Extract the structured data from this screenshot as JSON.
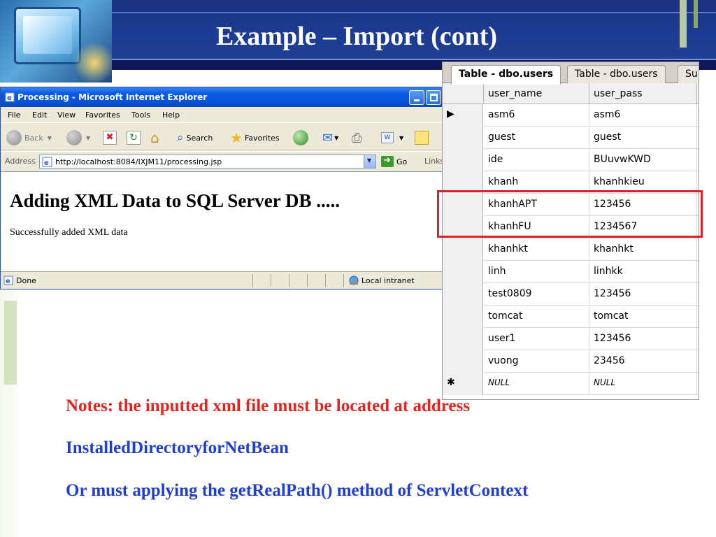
{
  "slide": {
    "title": "Example – Import (cont)",
    "colors": {
      "title_band": "#1c3c94",
      "accent_green": "#b7cf8e",
      "note_red": "#e8221c",
      "note_blue": "#1f3fd0",
      "highlight_red": "#e0202a"
    }
  },
  "browser": {
    "window_title": "Processing - Microsoft Internet Explorer",
    "menu": [
      "File",
      "Edit",
      "View",
      "Favorites",
      "Tools",
      "Help"
    ],
    "toolbar": {
      "back_label": "Back",
      "search_label": "Search",
      "favorites_label": "Favorites"
    },
    "address_label": "Address",
    "url": "http://localhost:8084/IXJM11/processing.jsp",
    "go_label": "Go",
    "links_label": "Links",
    "page_heading": "Adding XML Data to SQL Server DB .....",
    "page_message": "Successfully added XML data",
    "status_text": "Done",
    "zone_text": "Local intranet"
  },
  "table_view": {
    "tabs": [
      "Table - dbo.users",
      "Table - dbo.users",
      "Su"
    ],
    "columns": [
      "user_name",
      "user_pass"
    ],
    "rows": [
      {
        "marker": "▶",
        "user_name": "asm6",
        "user_pass": "asm6"
      },
      {
        "marker": "",
        "user_name": "guest",
        "user_pass": "guest"
      },
      {
        "marker": "",
        "user_name": "ide",
        "user_pass": "BUuvwKWD"
      },
      {
        "marker": "",
        "user_name": "khanh",
        "user_pass": "khanhkieu"
      },
      {
        "marker": "",
        "user_name": "khanhAPT",
        "user_pass": "123456"
      },
      {
        "marker": "",
        "user_name": "khanhFU",
        "user_pass": "1234567"
      },
      {
        "marker": "",
        "user_name": "khanhkt",
        "user_pass": "khanhkt"
      },
      {
        "marker": "",
        "user_name": "linh",
        "user_pass": "linhkk"
      },
      {
        "marker": "",
        "user_name": "test0809",
        "user_pass": "123456"
      },
      {
        "marker": "",
        "user_name": "tomcat",
        "user_pass": "tomcat"
      },
      {
        "marker": "",
        "user_name": "user1",
        "user_pass": "123456"
      },
      {
        "marker": "",
        "user_name": "vuong",
        "user_pass": "23456"
      },
      {
        "marker": "✱",
        "user_name": "NULL",
        "user_pass": "NULL"
      }
    ]
  },
  "notes": {
    "line1": "Notes: the inputted xml file must be located at address",
    "line2": "InstalledDirectoryforNetBean",
    "line3": "Or must applying the getRealPath() method of ServletContext"
  }
}
